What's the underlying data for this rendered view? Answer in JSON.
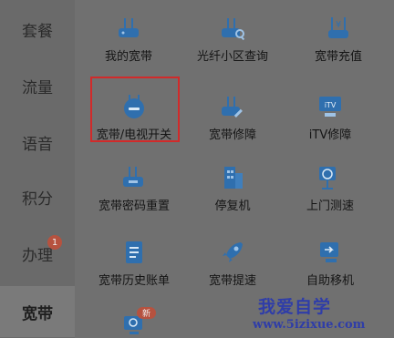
{
  "sidebar": {
    "items": [
      {
        "label": "套餐"
      },
      {
        "label": "流量"
      },
      {
        "label": "语音"
      },
      {
        "label": "积分"
      },
      {
        "label": "办理",
        "badge": "1"
      },
      {
        "label": "宽带",
        "active": true
      }
    ]
  },
  "grid": {
    "tiles": [
      {
        "label": "我的宽带",
        "icon": "router-icon"
      },
      {
        "label": "光纤小区查询",
        "icon": "router-search-icon"
      },
      {
        "label": "宽带充值",
        "icon": "router-yen-icon"
      },
      {
        "label": "宽带/电视开关",
        "icon": "power-switch-icon"
      },
      {
        "label": "宽带修障",
        "icon": "router-repair-icon"
      },
      {
        "label": "iTV修障",
        "icon": "itv-icon"
      },
      {
        "label": "宽带密码重置",
        "icon": "router-lock-icon"
      },
      {
        "label": "停复机",
        "icon": "building-icon"
      },
      {
        "label": "上门测速",
        "icon": "speedometer-icon"
      },
      {
        "label": "宽带历史账单",
        "icon": "bill-icon"
      },
      {
        "label": "宽带提速",
        "icon": "rocket-icon"
      },
      {
        "label": "自助移机",
        "icon": "move-icon"
      },
      {
        "label": "",
        "icon": "monitor-refresh-icon",
        "badge": "新"
      }
    ]
  },
  "watermark": {
    "title": "我爱自学",
    "url": "www.5izixue.com"
  },
  "colors": {
    "icon_blue": "#2f6fae",
    "highlight_red": "#d12a2a",
    "badge_red": "#b6523f"
  }
}
